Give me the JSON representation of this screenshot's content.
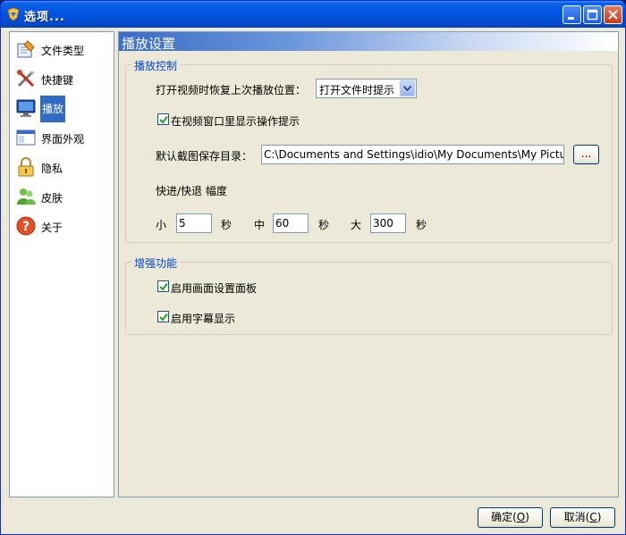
{
  "window": {
    "title": "选项..."
  },
  "sidebar": {
    "items": [
      {
        "label": "文件类型",
        "icon": "file-types-icon"
      },
      {
        "label": "快捷键",
        "icon": "shortcuts-icon"
      },
      {
        "label": "播放",
        "icon": "monitor-icon",
        "active": true
      },
      {
        "label": "界面外观",
        "icon": "window-appearance-icon"
      },
      {
        "label": "隐私",
        "icon": "lock-icon"
      },
      {
        "label": "皮肤",
        "icon": "users-icon"
      },
      {
        "label": "关于",
        "icon": "help-icon"
      }
    ]
  },
  "panel": {
    "title": "播放设置",
    "playback": {
      "group_title": "播放控制",
      "resume_label": "打开视频时恢复上次播放位置：",
      "resume_value": "打开文件时提示",
      "show_hints_label": "在视频窗口里显示操作提示",
      "show_hints_checked": true,
      "screenshot_dir_label": "默认截图保存目录：",
      "screenshot_dir_value": "C:\\Documents and Settings\\idio\\My Documents\\My Pictures",
      "browse_label": "...",
      "seek_label": "快进/快退 幅度",
      "small_label": "小",
      "small_value": "5",
      "medium_label": "中",
      "medium_value": "60",
      "large_label": "大",
      "large_value": "300",
      "unit": "秒"
    },
    "enhance": {
      "group_title": "增强功能",
      "picture_panel_label": "启用画面设置面板",
      "picture_panel_checked": true,
      "subtitle_label": "启用字幕显示",
      "subtitle_checked": true
    }
  },
  "footer": {
    "ok_label": "确定(",
    "ok_key": "O",
    "ok_close": ")",
    "cancel_label": "取消(",
    "cancel_key": "C",
    "cancel_close": ")"
  },
  "colors": {
    "accent": "#316ac5",
    "group_title": "#0046d5",
    "titlebar": "#0054e3"
  }
}
